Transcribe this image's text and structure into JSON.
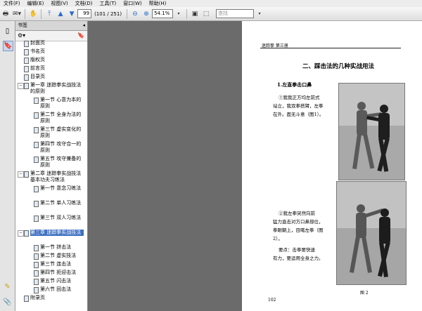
{
  "menu": [
    "文件(F)",
    "编辑(E)",
    "视图(V)",
    "文档(D)",
    "工具(T)",
    "窗口(W)",
    "帮助(H)"
  ],
  "toolbar": {
    "page_current": "99",
    "page_total": "(101 / 251)",
    "zoom": "54.1%",
    "search_placeholder": "查找"
  },
  "panel": {
    "title": "书签",
    "collapse_glyph": "◂"
  },
  "bookmarks": [
    {
      "label": "封面页",
      "level": 1
    },
    {
      "label": "书名页",
      "level": 1
    },
    {
      "label": "版权页",
      "level": 1
    },
    {
      "label": "前言页",
      "level": 1
    },
    {
      "label": "目录页",
      "level": 1
    },
    {
      "label": "第一章 迷踪拳实战技法的原则",
      "level": 1,
      "expander": "−"
    },
    {
      "label": "第一节 心意为本的原则",
      "level": 2
    },
    {
      "label": "第二节 全身为法的原则",
      "level": 2
    },
    {
      "label": "第三节 虚实变化的原则",
      "level": 2
    },
    {
      "label": "第四节 攻守合一的原则",
      "level": 2
    },
    {
      "label": "第五节 攻守兼备的原则",
      "level": 2
    },
    {
      "label": "第二章 迷踪拳实战技法基本功夫习练法",
      "level": 1,
      "expander": "−"
    },
    {
      "label": "第一节 意念习练法",
      "level": 2
    },
    {
      "label": "第二节 单人习练法",
      "level": 2
    },
    {
      "label": "第三节 双人习练法",
      "level": 2
    },
    {
      "label": "第三章 迷踪拳实战技法",
      "level": 1,
      "expander": "−",
      "selected": true
    },
    {
      "label": "第一节 拼击法",
      "level": 2
    },
    {
      "label": "第二节 虚实技法",
      "level": 2
    },
    {
      "label": "第三节 连击法",
      "level": 2
    },
    {
      "label": "第四节 拒迎击法",
      "level": 2
    },
    {
      "label": "第五节 闪击法",
      "level": 2
    },
    {
      "label": "第六节 回击法",
      "level": 2
    },
    {
      "label": "附录页",
      "level": 1
    }
  ],
  "document": {
    "running_header": "迷踪拳   第三册",
    "section_title": "二、踩击法的几种实战用法",
    "subsection": "1.左直拳击口鼻",
    "para1": [
      "①我我正方均左前式",
      "站立，我双拳搭臂，左拳",
      "在外。面无斗意（图1）。"
    ],
    "fig1_caption": "图 1",
    "para2": [
      "②我左拳突然向前",
      "猛力直击对方口鼻部位，",
      "拳眼朝上，目睹左拳（图",
      "2）。"
    ],
    "para3": [
      "要点：击拳要快速",
      "有力，要运用全身之力。"
    ],
    "fig2_caption": "图 2",
    "page_number": "102"
  }
}
